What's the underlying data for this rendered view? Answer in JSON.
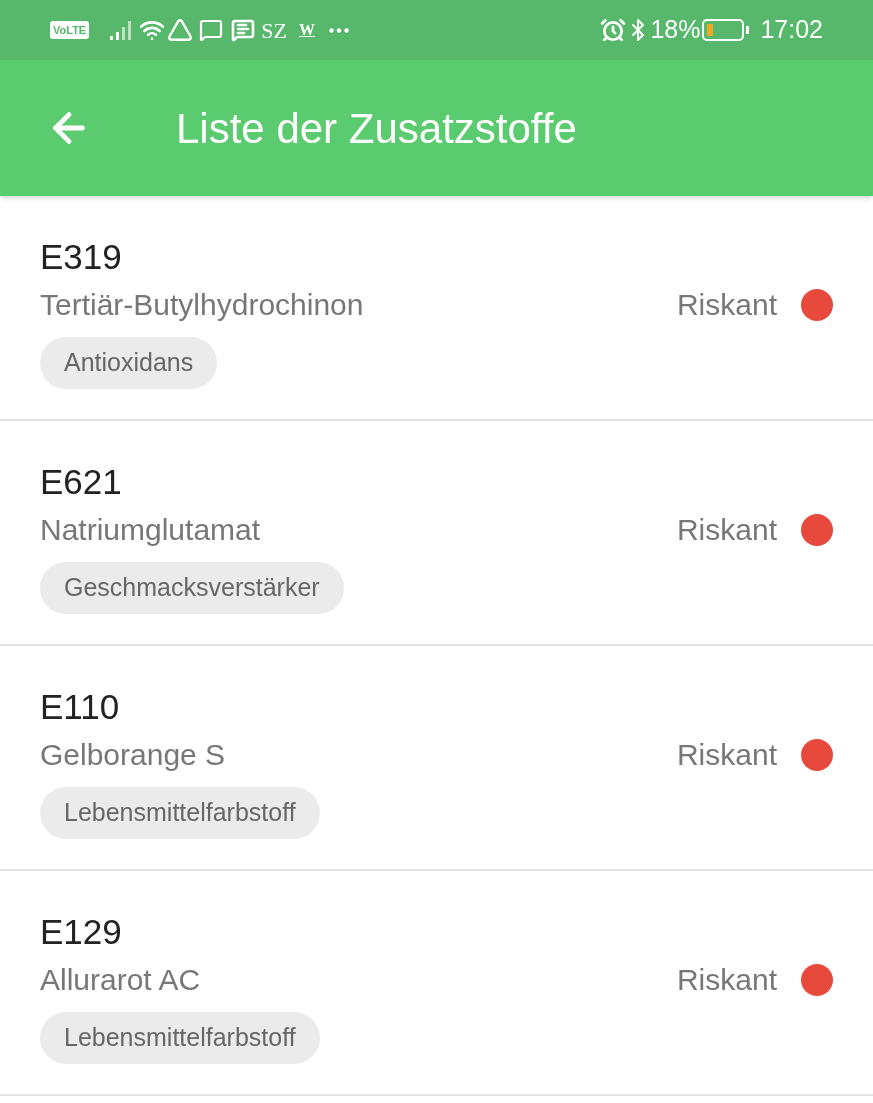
{
  "status_bar": {
    "left_texts": [
      "VoLTE",
      "SZ",
      "W"
    ],
    "battery": "18%",
    "time": "17:02"
  },
  "app_bar": {
    "title": "Liste der Zusatzstoffe"
  },
  "additives": [
    {
      "code": "E319",
      "name": "Tertiär-Butylhydrochinon",
      "rating": "Riskant",
      "color": "#e8493d",
      "category": "Antioxidans"
    },
    {
      "code": "E621",
      "name": "Natriumglutamat",
      "rating": "Riskant",
      "color": "#e8493d",
      "category": "Geschmacksverstärker"
    },
    {
      "code": "E110",
      "name": "Gelborange S",
      "rating": "Riskant",
      "color": "#e8493d",
      "category": "Lebensmittelfarbstoff"
    },
    {
      "code": "E129",
      "name": "Allurarot AC",
      "rating": "Riskant",
      "color": "#e8493d",
      "category": "Lebensmittelfarbstoff"
    }
  ]
}
